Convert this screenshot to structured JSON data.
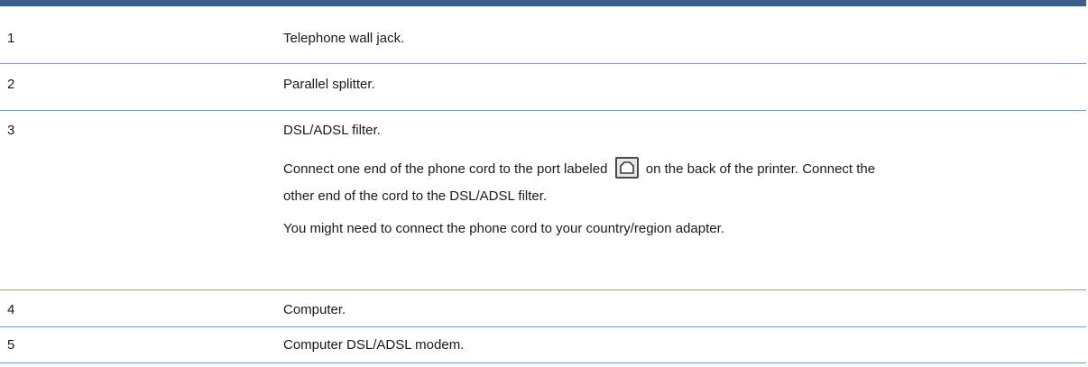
{
  "rows": [
    {
      "number": "1",
      "description": "Telephone wall jack."
    },
    {
      "number": "2",
      "description": "Parallel splitter."
    },
    {
      "number": "3",
      "description": "DSL/ADSL filter.",
      "detail_before_icon": "Connect one end of the phone cord to the port labeled",
      "detail_after_icon": "on the back of the printer. Connect the",
      "detail_line2": "other end of the cord to the DSL/ADSL filter.",
      "note": "You might need to connect the phone cord to your country/region adapter.",
      "port_icon": "phone-port-icon"
    },
    {
      "number": "4",
      "description": "Computer."
    },
    {
      "number": "5",
      "description": "Computer DSL/ADSL modem."
    }
  ],
  "colors": {
    "header_rule": "#3a5e8f",
    "row_divider": "#8a9ab0"
  }
}
